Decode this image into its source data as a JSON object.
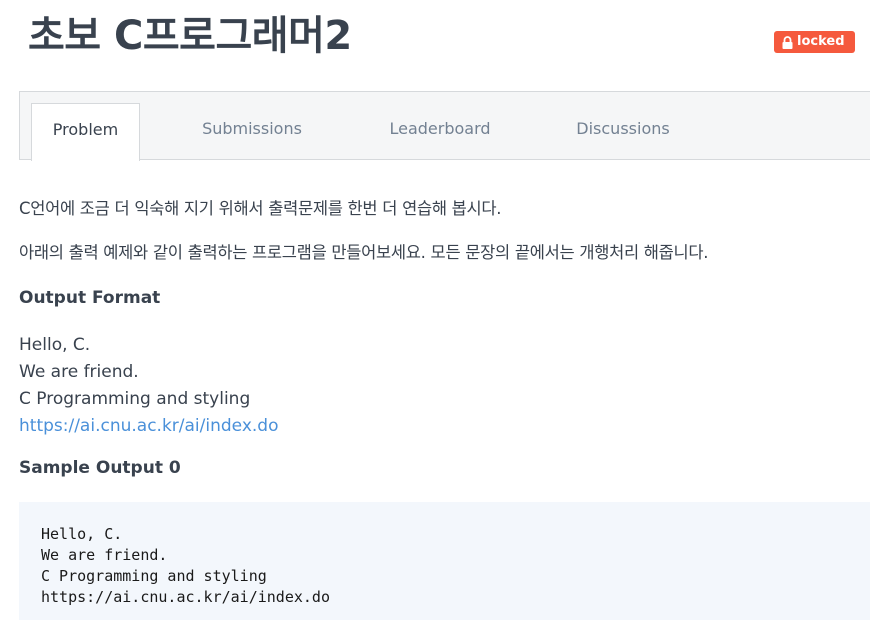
{
  "header": {
    "title": "초보 C프로그래머2",
    "badge_label": "locked"
  },
  "tabs": [
    {
      "label": "Problem",
      "active": true
    },
    {
      "label": "Submissions",
      "active": false
    },
    {
      "label": "Leaderboard",
      "active": false
    },
    {
      "label": "Discussions",
      "active": false
    }
  ],
  "problem": {
    "paragraph1": "C언어에 조금 더 익숙해 지기 위해서 출력문제를 한번 더 연습해 봅시다.",
    "paragraph2": "아래의 출력 예제와 같이 출력하는 프로그램을 만들어보세요. 모든 문장의 끝에서는 개행처리 해줍니다.",
    "output_format_heading": "Output Format",
    "output_lines": [
      "Hello, C.",
      "We are friend.",
      "C Programming and styling"
    ],
    "output_link": "https://ai.cnu.ac.kr/ai/index.do",
    "sample_heading": "Sample Output 0",
    "sample_code": "Hello, C.\nWe are friend.\nC Programming and styling\nhttps://ai.cnu.ac.kr/ai/index.do"
  },
  "colors": {
    "badge": "#f5593d",
    "link": "#4a90d9",
    "text": "#39424e",
    "tab_inactive": "#738192",
    "code_bg": "#f3f7fc"
  }
}
